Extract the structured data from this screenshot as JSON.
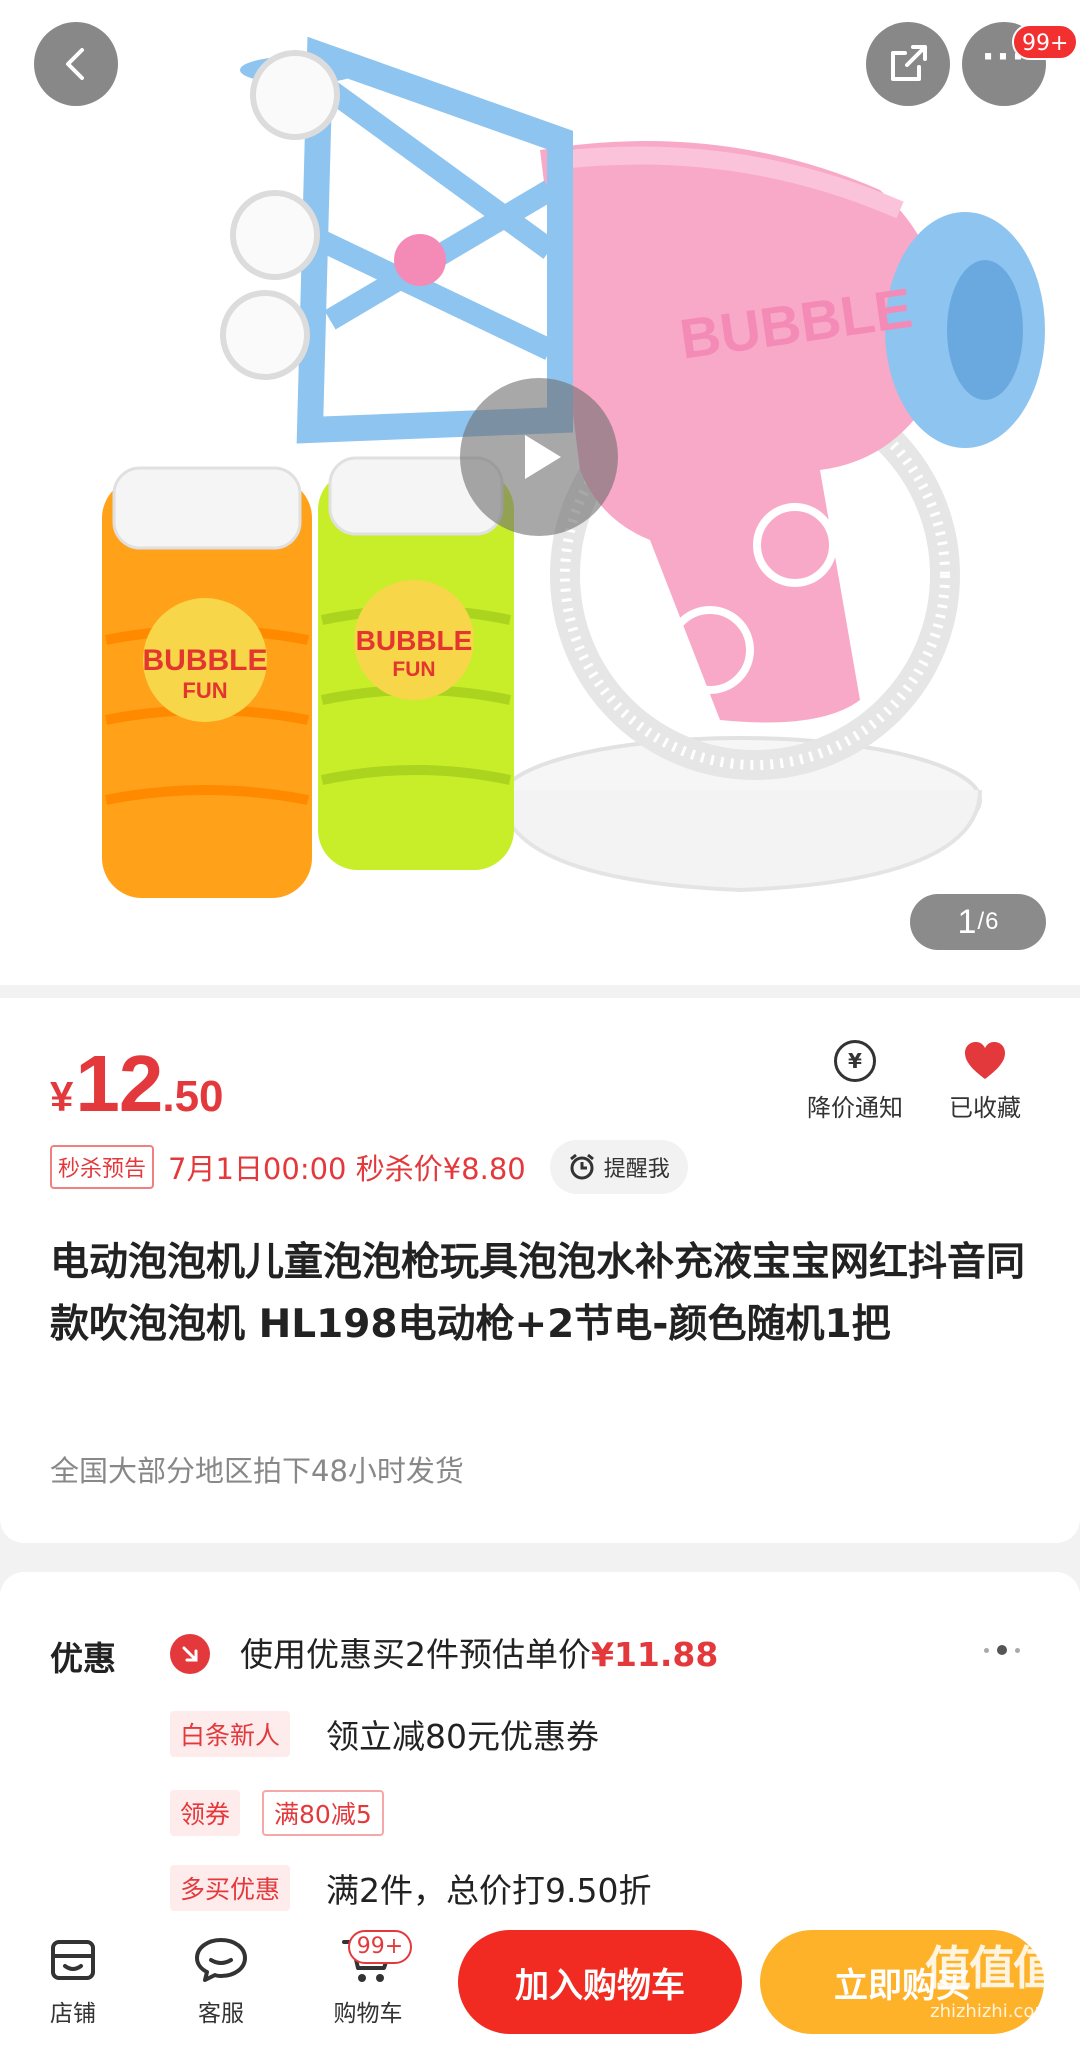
{
  "header": {
    "more_badge": "99+"
  },
  "gallery": {
    "current": "1",
    "separator": "/",
    "total": "6"
  },
  "product_art": {
    "toy_text": "BUBBLE",
    "bottle_text_1": "BUBBLE",
    "bottle_text_2": "FUN"
  },
  "price": {
    "currency": "¥",
    "integer": "12",
    "decimal": ".50"
  },
  "actions": {
    "price_alert": "降价通知",
    "favorited": "已收藏"
  },
  "flash_sale": {
    "tag": "秒杀预告",
    "text": "7月1日00:00 秒杀价¥8.80",
    "remind": "提醒我"
  },
  "title": "电动泡泡机儿童泡泡枪玩具泡泡水补充液宝宝网红抖音同款吹泡泡机 HL198电动枪+2节电-颜色随机1把",
  "shipping": "全国大部分地区拍下48小时发货",
  "promo": {
    "label": "优惠",
    "main_prefix": "使用优惠买2件预估单价",
    "main_price": "¥11.88",
    "rows": [
      {
        "tag": "白条新人",
        "text": "领立减80元优惠券"
      },
      {
        "tag": "领券",
        "coupon": "满80减5"
      },
      {
        "tag": "多买优惠",
        "text": "满2件，总价打9.50折"
      }
    ]
  },
  "bottom_bar": {
    "shop": "店铺",
    "service": "客服",
    "cart": "购物车",
    "cart_badge": "99+",
    "add_to_cart": "加入购物车",
    "buy_now": "立即购买"
  },
  "watermark": {
    "logo": "值值值",
    "url": "zhizhizhi.com"
  },
  "colors": {
    "accent_red": "#e4393c",
    "cart_button": "#f12a22",
    "buy_button": "#fdb22a"
  }
}
